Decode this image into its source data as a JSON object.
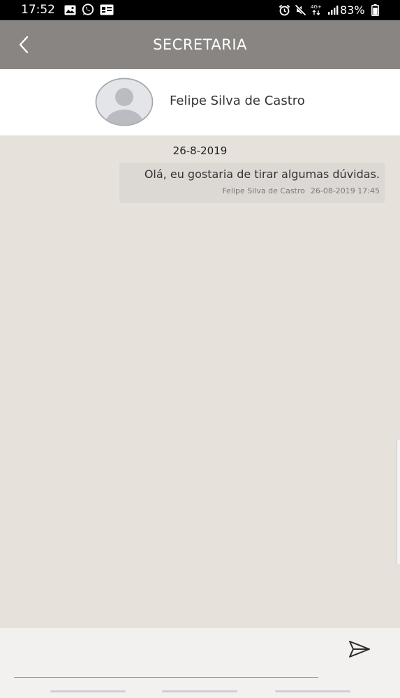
{
  "status_bar": {
    "time": "17:52",
    "left_icons": [
      "image-icon",
      "whatsapp-icon",
      "notification-icon"
    ],
    "right_icons": [
      "alarm-icon",
      "mute-icon",
      "network-4g-icon",
      "signal-icon"
    ],
    "network_label": "4G+",
    "battery_text": "83%"
  },
  "header": {
    "back_icon": "back-arrow-icon",
    "title": "SECRETARIA"
  },
  "contact": {
    "avatar_icon": "default-avatar-icon",
    "name": "Felipe Silva de Castro"
  },
  "chat": {
    "date_separator": "26-8-2019",
    "messages": [
      {
        "text": "Olá, eu gostaria de tirar algumas dúvidas.",
        "sender": "Felipe Silva de Castro",
        "timestamp": "26-08-2019 17:45"
      }
    ]
  },
  "input": {
    "value": "",
    "send_icon": "send-icon"
  },
  "colors": {
    "status_bar": "#000000",
    "header": "#888583",
    "contact_bar": "#ffffff",
    "chat_background": "#e6e1da",
    "bubble": "#dcd8d4",
    "input_bar": "#f3f1f0"
  }
}
